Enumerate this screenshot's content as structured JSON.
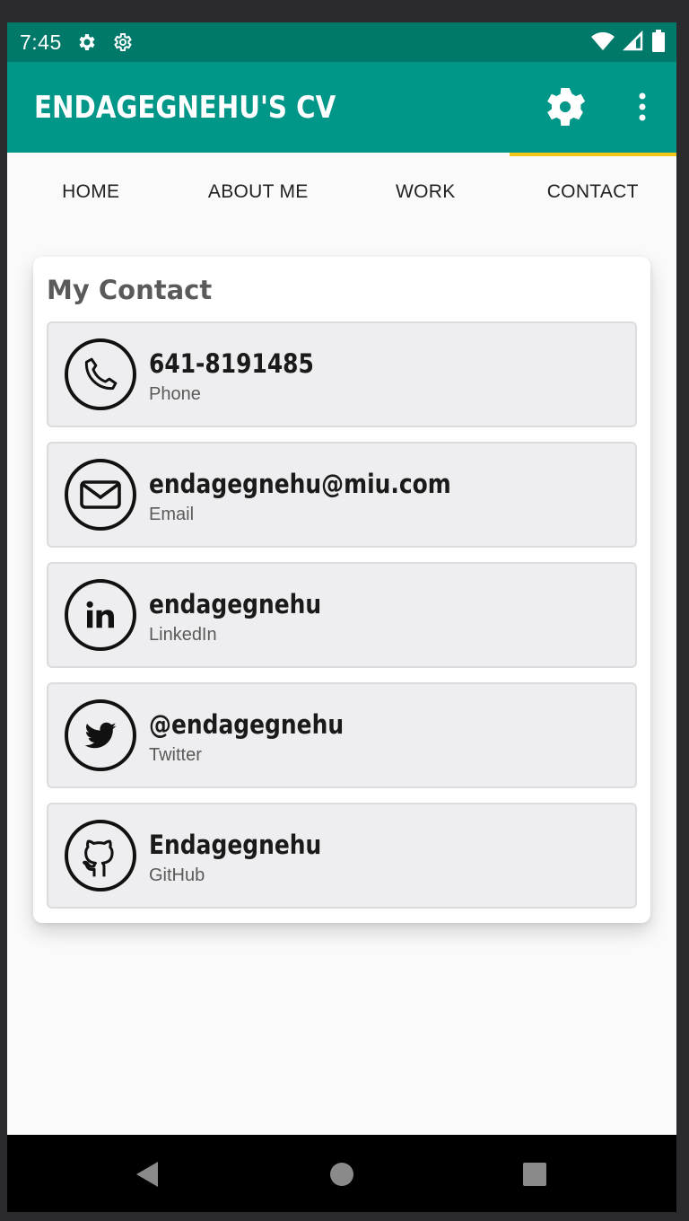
{
  "status_bar": {
    "time": "7:45",
    "icons": [
      "gear-icon",
      "settings-outline-icon",
      "wifi-icon",
      "signal-icon",
      "battery-icon"
    ]
  },
  "app_bar": {
    "title": "ENDAGEGNEHU'S CV",
    "actions": [
      "settings-icon",
      "more-vert-icon"
    ],
    "color": "#009688"
  },
  "tabs": [
    {
      "label": "HOME",
      "selected": false
    },
    {
      "label": "ABOUT ME",
      "selected": false
    },
    {
      "label": "WORK",
      "selected": false
    },
    {
      "label": "CONTACT",
      "selected": true
    }
  ],
  "tab_indicator_color": "#f5c518",
  "card": {
    "title": "My Contact",
    "items": [
      {
        "value": "641-8191485",
        "label": "Phone",
        "icon": "phone-icon"
      },
      {
        "value": "endagegnehu@miu.com",
        "label": "Email",
        "icon": "email-icon"
      },
      {
        "value": "endagegnehu",
        "label": "LinkedIn",
        "icon": "linkedin-icon"
      },
      {
        "value": "@endagegnehu",
        "label": "Twitter",
        "icon": "twitter-icon"
      },
      {
        "value": "Endagegnehu",
        "label": "GitHub",
        "icon": "github-icon"
      }
    ]
  },
  "nav_bar": [
    "back-icon",
    "home-icon",
    "recents-icon"
  ]
}
